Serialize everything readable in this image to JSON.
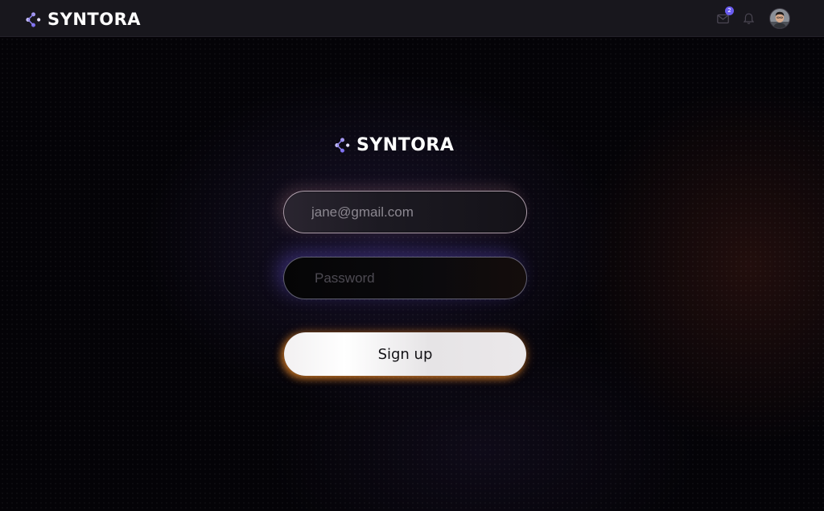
{
  "app": {
    "brand_name": "SYNTORA"
  },
  "header": {
    "notifications": {
      "mail_icon": "mail-icon",
      "mail_badge_count": "2",
      "bell_icon": "bell-icon"
    },
    "avatar_icon": "user-avatar"
  },
  "form": {
    "email": {
      "value": "",
      "placeholder": "jane@gmail.com"
    },
    "password": {
      "value": "",
      "placeholder": "Password"
    },
    "submit_label": "Sign up"
  },
  "colors": {
    "background": "#050407",
    "topbar": "#18171d",
    "accent_purple": "#6a5cf0",
    "glow_orange": "#f08c28",
    "button_bg": "#f2f0f1"
  }
}
